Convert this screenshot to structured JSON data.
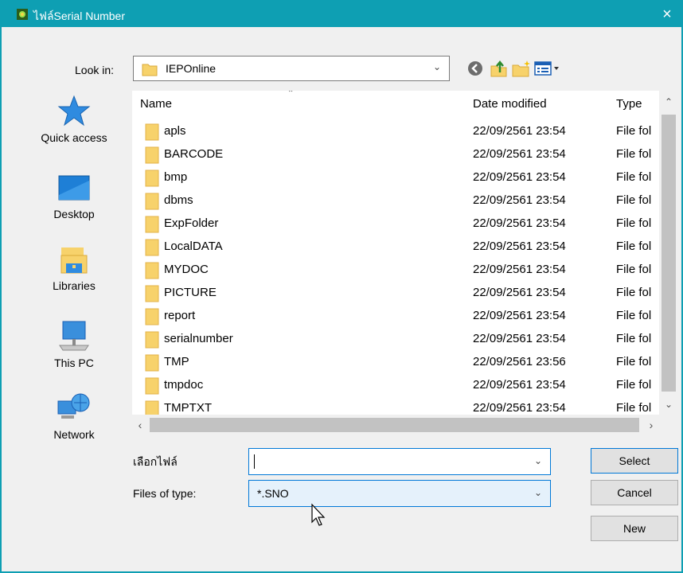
{
  "window": {
    "title": "ไฟล์Serial Number",
    "close": "×"
  },
  "toolbar": {
    "look_in_label": "Look in:",
    "look_in_value": "IEPOnline",
    "icons": [
      "back-icon",
      "up-folder-icon",
      "new-folder-icon",
      "view-menu-icon"
    ]
  },
  "places": [
    {
      "label": "Quick access",
      "icon": "star-icon"
    },
    {
      "label": "Desktop",
      "icon": "desktop-icon"
    },
    {
      "label": "Libraries",
      "icon": "libraries-icon"
    },
    {
      "label": "This PC",
      "icon": "computer-icon"
    },
    {
      "label": "Network",
      "icon": "network-icon"
    }
  ],
  "columns": {
    "name": "Name",
    "date": "Date modified",
    "type": "Type"
  },
  "files": [
    {
      "name": "apls",
      "date": "22/09/2561 23:54",
      "type": "File fol"
    },
    {
      "name": "BARCODE",
      "date": "22/09/2561 23:54",
      "type": "File fol"
    },
    {
      "name": "bmp",
      "date": "22/09/2561 23:54",
      "type": "File fol"
    },
    {
      "name": "dbms",
      "date": "22/09/2561 23:54",
      "type": "File fol"
    },
    {
      "name": "ExpFolder",
      "date": "22/09/2561 23:54",
      "type": "File fol"
    },
    {
      "name": "LocalDATA",
      "date": "22/09/2561 23:54",
      "type": "File fol"
    },
    {
      "name": "MYDOC",
      "date": "22/09/2561 23:54",
      "type": "File fol"
    },
    {
      "name": "PICTURE",
      "date": "22/09/2561 23:54",
      "type": "File fol"
    },
    {
      "name": "report",
      "date": "22/09/2561 23:54",
      "type": "File fol"
    },
    {
      "name": "serialnumber",
      "date": "22/09/2561 23:54",
      "type": "File fol"
    },
    {
      "name": "TMP",
      "date": "22/09/2561 23:56",
      "type": "File fol"
    },
    {
      "name": "tmpdoc",
      "date": "22/09/2561 23:54",
      "type": "File fol"
    },
    {
      "name": "TMPTXT",
      "date": "22/09/2561 23:54",
      "type": "File fol"
    }
  ],
  "form": {
    "file_label": "เลือกไฟล์",
    "file_value": "",
    "type_label": "Files of type:",
    "type_value": "*.SNO"
  },
  "buttons": {
    "select": "Select",
    "cancel": "Cancel",
    "new": "New"
  },
  "colors": {
    "titlebar": "#0e9fb3",
    "folder": "#f7d26b",
    "accent": "#0078d7"
  }
}
